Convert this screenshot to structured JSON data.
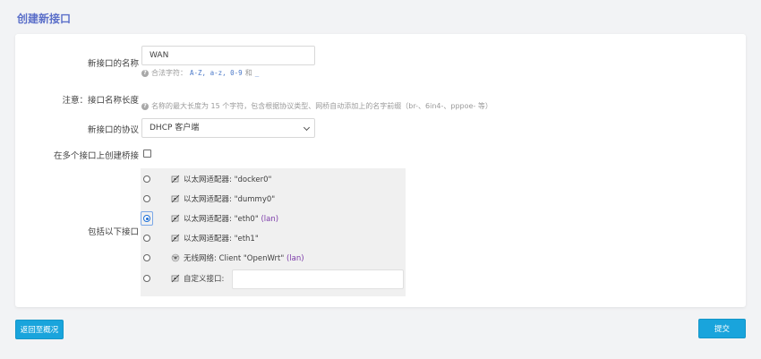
{
  "page": {
    "title": "创建新接口"
  },
  "form": {
    "name_label": "新接口的名称",
    "name_value": "WAN",
    "name_hint_prefix": "合法字符：",
    "name_hint_chars": "A-Z, a-z, 0-9",
    "name_hint_and": "和",
    "name_hint_underscore": "_",
    "note_label": "注意：接口名称长度",
    "note_hint": "名称的最大长度为 15 个字符，包含根据协议类型、网桥自动添加上的名字前缀（br-、6in4-、pppoe- 等）",
    "protocol_label": "新接口的协议",
    "protocol_value": "DHCP 客户端",
    "bridge_label": "在多个接口上创建桥接",
    "bridge_checked": false,
    "cover_label": "包括以下接口",
    "interfaces": [
      {
        "type": "ethernet",
        "label": "以太网适配器: \"docker0\"",
        "tag": "",
        "checked": false
      },
      {
        "type": "ethernet",
        "label": "以太网适配器: \"dummy0\"",
        "tag": "",
        "checked": false
      },
      {
        "type": "ethernet",
        "label": "以太网适配器: \"eth0\"",
        "tag": "(lan)",
        "checked": true
      },
      {
        "type": "ethernet",
        "label": "以太网适配器: \"eth1\"",
        "tag": "",
        "checked": false
      },
      {
        "type": "wireless",
        "label": "无线网络: Client \"OpenWrt\"",
        "tag": "(lan)",
        "checked": false
      }
    ],
    "custom_label": "自定义接口:",
    "custom_value": ""
  },
  "buttons": {
    "back": "返回至概况",
    "submit": "提交"
  },
  "colors": {
    "accent": "#19a4dc",
    "title": "#5b6fc9",
    "tag": "#7b3aa8"
  },
  "icons": {
    "ethernet": "ethernet-adapter-icon",
    "wireless": "wireless-icon",
    "help": "help-icon"
  }
}
